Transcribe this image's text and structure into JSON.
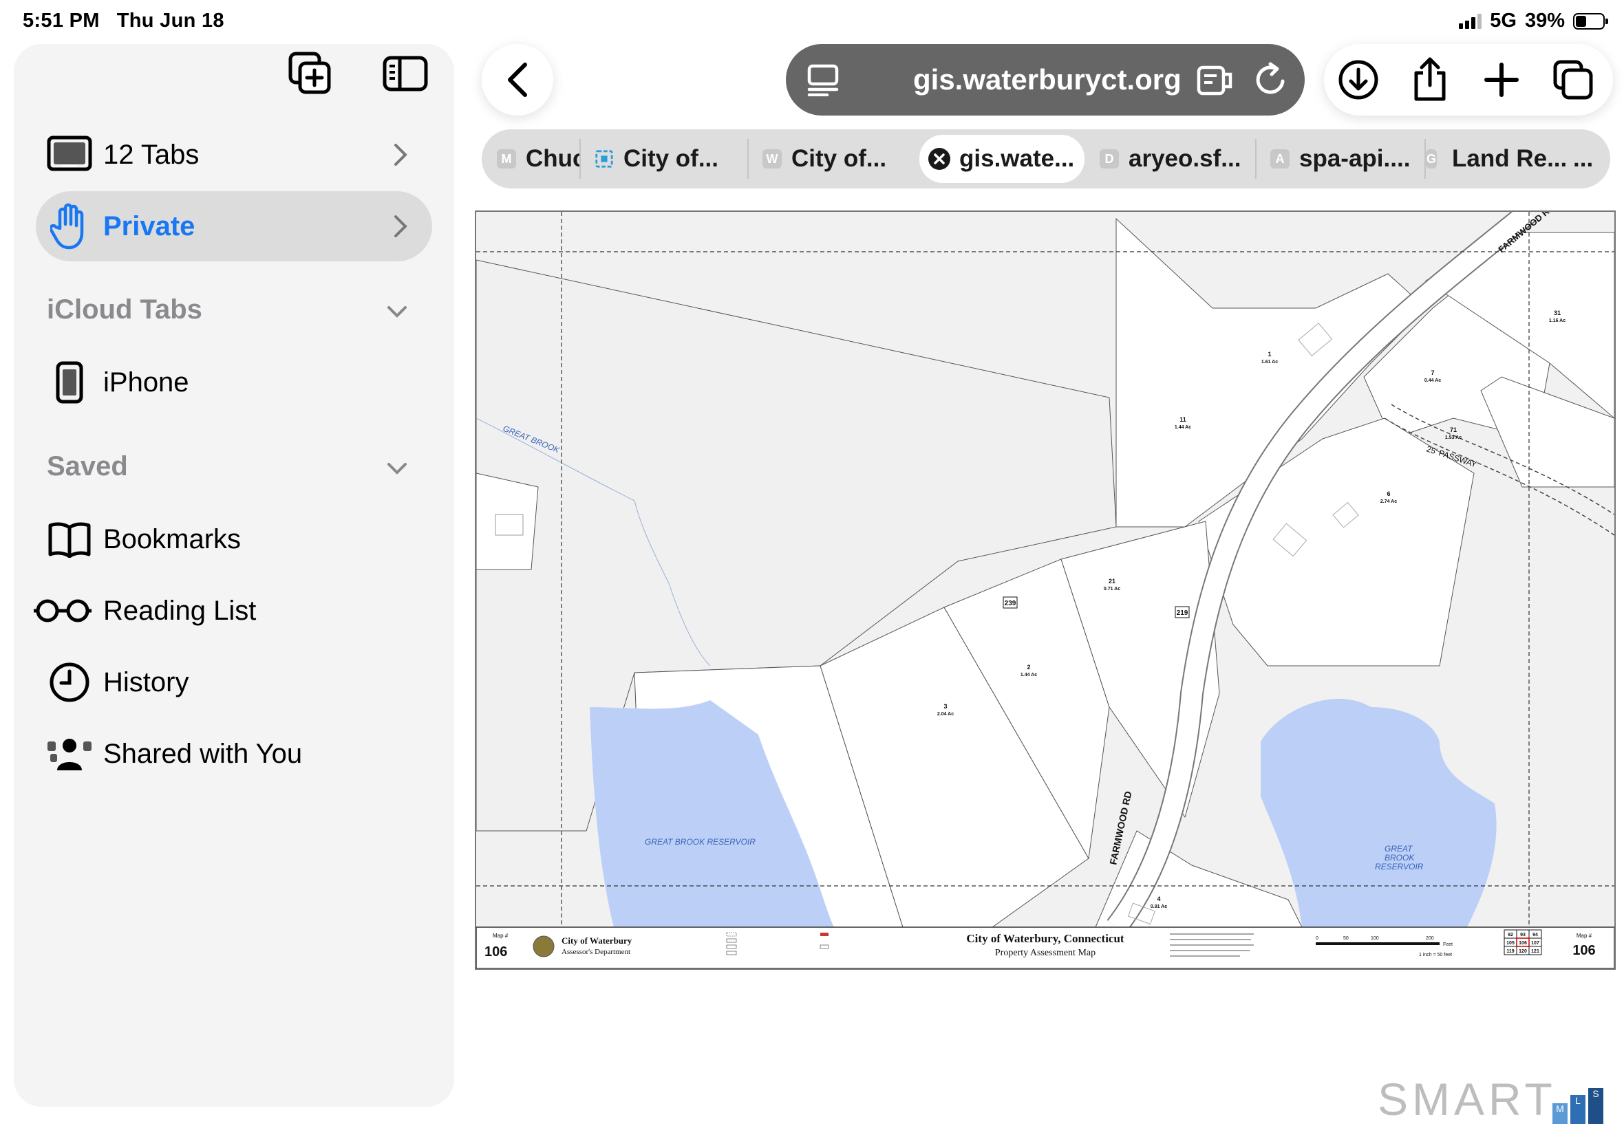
{
  "status": {
    "time": "5:51 PM",
    "date": "Thu Jun 18",
    "network": "5G",
    "battery": "39%",
    "battery_level": 0.39
  },
  "sidebar": {
    "tab_groups": [
      {
        "label": "12 Tabs",
        "icon": "laptop-icon"
      },
      {
        "label": "Private",
        "icon": "hand-icon",
        "active": true
      }
    ],
    "icloud_section": "iCloud Tabs",
    "icloud_devices": [
      {
        "label": "iPhone",
        "icon": "iphone-icon"
      }
    ],
    "saved_section": "Saved",
    "saved_items": [
      {
        "label": "Bookmarks",
        "icon": "book-icon"
      },
      {
        "label": "Reading List",
        "icon": "glasses-icon"
      },
      {
        "label": "History",
        "icon": "clock-icon"
      },
      {
        "label": "Shared with You",
        "icon": "shared-people-icon"
      }
    ]
  },
  "toolbar": {
    "url": "gis.waterburyct.org"
  },
  "tabs": [
    {
      "fav": "M",
      "label": "Chuc"
    },
    {
      "fav": "",
      "label": "City of..."
    },
    {
      "fav": "W",
      "label": "City of..."
    },
    {
      "fav": "",
      "label": "gis.wate...",
      "active": true
    },
    {
      "fav": "D",
      "label": "aryeo.sf..."
    },
    {
      "fav": "A",
      "label": "spa-api...."
    },
    {
      "fav": "G",
      "label": "Land Re..."
    }
  ],
  "tabs_more": "...",
  "map": {
    "road_labels": [
      "FARMWOOD RD",
      "FARMWOOD RD",
      "25' PASSWAY"
    ],
    "water_labels": [
      "GREAT BROOK",
      "GREAT BROOK RESERVOIR",
      "GREAT",
      "BROOK",
      "RESERVOIR"
    ],
    "lots": [
      {
        "num": "1",
        "area": "1.61 Ac"
      },
      {
        "num": "7",
        "area": "0.44 Ac"
      },
      {
        "num": "31",
        "area": "1.16 Ac"
      },
      {
        "num": "11",
        "area": "1.44 Ac"
      },
      {
        "num": "71",
        "area": "1.53 Ac"
      },
      {
        "num": "6",
        "area": "2.74 Ac"
      },
      {
        "num": "21",
        "area": "0.71 Ac"
      },
      {
        "num": "2",
        "area": "1.44 Ac"
      },
      {
        "num": "3",
        "area": "2.04 Ac"
      },
      {
        "num": "4",
        "area": "0.91 Ac"
      }
    ],
    "addresses": [
      "239",
      "219"
    ],
    "title_block": {
      "map_label": "Map #",
      "map_number": "106",
      "org_name": "City of Waterbury",
      "org_dept": "Assessor's Department",
      "map_title": "City of Waterbury, Connecticut",
      "map_subtitle": "Property Assessment Map",
      "scale_text": "1 inch = 50 feet",
      "scale_ticks": [
        "0",
        "50",
        "100",
        "200"
      ],
      "scale_unit": "Feet",
      "grid": [
        [
          "92",
          "93",
          "94"
        ],
        [
          "105",
          "106",
          "107"
        ],
        [
          "119",
          "120",
          "121"
        ]
      ]
    }
  },
  "watermark": {
    "text": "SMART",
    "letters": [
      "M",
      "L",
      "S"
    ]
  },
  "colors": {
    "accent": "#1877f2",
    "water": "#bcd0f7",
    "address_bar": "#666666"
  }
}
